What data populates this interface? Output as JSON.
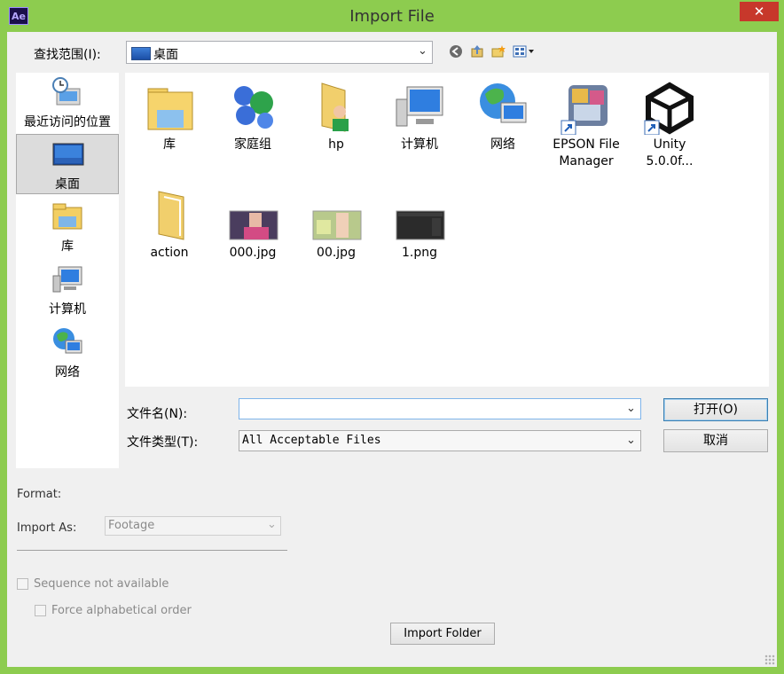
{
  "window": {
    "title": "Import File",
    "app_icon_text": "Ae",
    "close_glyph": "✕"
  },
  "lookin": {
    "label": "查找范围(I):",
    "value": "桌面"
  },
  "places": [
    {
      "label": "最近访问的位置",
      "icon": "recent-places-icon"
    },
    {
      "label": "桌面",
      "icon": "desktop-icon",
      "selected": true
    },
    {
      "label": "库",
      "icon": "libraries-icon"
    },
    {
      "label": "计算机",
      "icon": "computer-icon"
    },
    {
      "label": "网络",
      "icon": "network-icon"
    }
  ],
  "files": [
    {
      "label": "库",
      "icon": "libraries-folder-icon"
    },
    {
      "label": "家庭组",
      "icon": "homegroup-icon"
    },
    {
      "label": "hp",
      "icon": "user-folder-icon"
    },
    {
      "label": "计算机",
      "icon": "computer-icon"
    },
    {
      "label": "网络",
      "icon": "network-icon"
    },
    {
      "label": "EPSON File Manager",
      "icon": "epson-shortcut-icon"
    },
    {
      "label": "Unity 5.0.0f...",
      "icon": "unity-shortcut-icon"
    },
    {
      "label": "action",
      "icon": "folder-icon"
    },
    {
      "label": "000.jpg",
      "icon": "image-thumbnail"
    },
    {
      "label": "00.jpg",
      "icon": "image-thumbnail"
    },
    {
      "label": "1.png",
      "icon": "image-thumbnail"
    }
  ],
  "filename": {
    "label": "文件名(N):",
    "value": ""
  },
  "filetype": {
    "label": "文件类型(T):",
    "value": "All Acceptable Files"
  },
  "buttons": {
    "open": "打开(O)",
    "cancel": "取消",
    "import_folder": "Import Folder"
  },
  "format": {
    "label": "Format:"
  },
  "import_as": {
    "label": "Import As:",
    "value": "Footage"
  },
  "sequence": {
    "label": "Sequence not available",
    "checked": false
  },
  "alphabetical": {
    "label": "Force alphabetical order",
    "checked": false
  },
  "colors": {
    "frame": "#8dcc4f",
    "close": "#c7382b",
    "dialog_bg": "#f0f0f0"
  }
}
